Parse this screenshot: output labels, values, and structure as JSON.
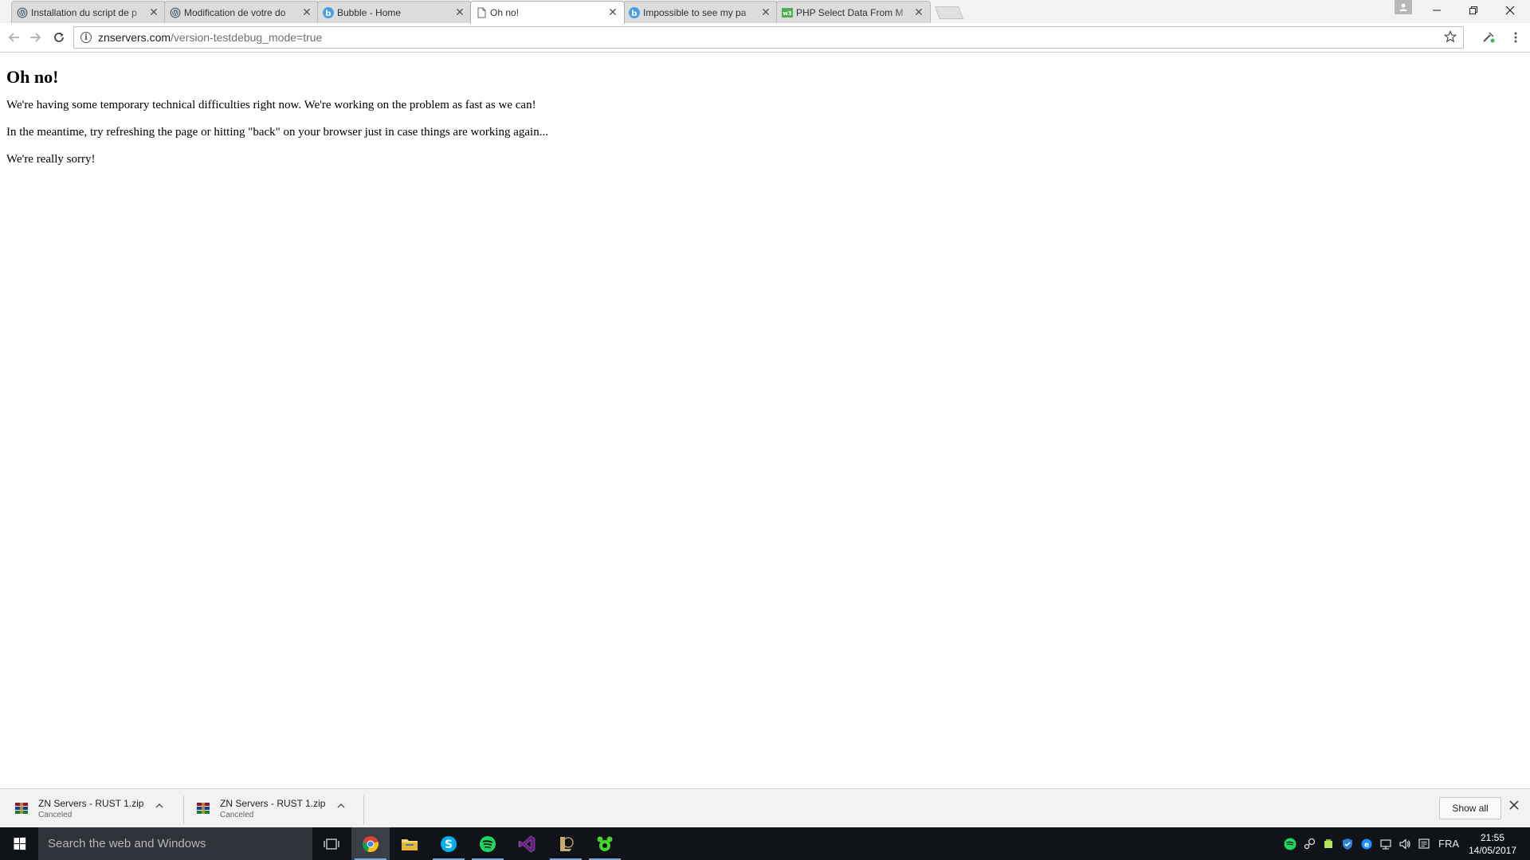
{
  "browser": {
    "tabs": [
      {
        "title": "Installation du script de p",
        "favicon": "wordpress-icon"
      },
      {
        "title": "Modification de votre do",
        "favicon": "wordpress-icon"
      },
      {
        "title": "Bubble - Home",
        "favicon": "bubble-icon"
      },
      {
        "title": "Oh no!",
        "favicon": "document-icon"
      },
      {
        "title": "Impossible to see my pa",
        "favicon": "bubble-icon"
      },
      {
        "title": "PHP Select Data From M",
        "favicon": "w3schools-icon"
      }
    ],
    "active_tab": 3,
    "close_glyph": "✕",
    "address": {
      "host": "znservers.com",
      "path": "/version-testdebug_mode=true"
    }
  },
  "page": {
    "heading": "Oh no!",
    "paragraphs": [
      "We're having some temporary technical difficulties right now. We're working on the problem as fast as we can!",
      "In the meantime, try refreshing the page or hitting \"back\" on your browser just in case things are working again...",
      "We're really sorry!"
    ]
  },
  "downloads": {
    "items": [
      {
        "filename": "ZN Servers - RUST 1.zip",
        "status": "Canceled"
      },
      {
        "filename": "ZN Servers - RUST 1.zip",
        "status": "Canceled"
      }
    ],
    "show_all_label": "Show all"
  },
  "taskbar": {
    "search_placeholder": "Search the web and Windows",
    "apps": [
      "task-view-icon",
      "chrome-icon",
      "file-explorer-icon",
      "skype-icon",
      "spotify-icon",
      "visual-studio-icon",
      "league-of-legends-icon",
      "razer-icon"
    ],
    "language": "FRA",
    "time": "21:55",
    "date": "14/05/2017"
  },
  "colors": {
    "taskbar_bg": "#101418",
    "search_bg": "#2f3238",
    "spotify_green": "#1ed760",
    "skype_blue": "#00aff0",
    "vs_purple": "#68217a"
  }
}
